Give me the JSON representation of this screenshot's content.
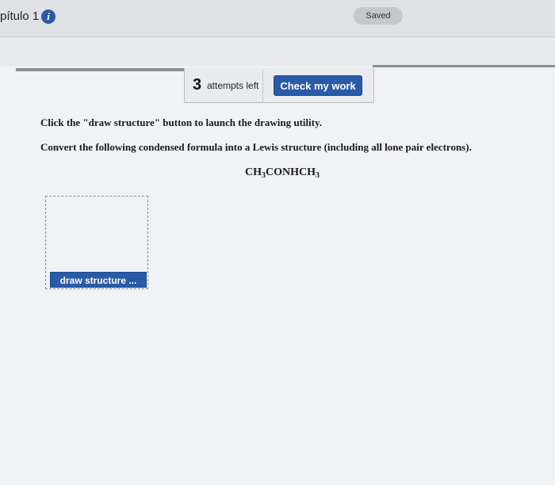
{
  "header": {
    "chapter_label": "pítulo 1",
    "saved_label": "Saved"
  },
  "attempts": {
    "count": "3",
    "label": "attempts left",
    "check_button": "Check my work"
  },
  "question": {
    "instruction_1": "Click the \"draw structure\" button to launch the drawing utility.",
    "instruction_2": "Convert the following condensed formula into a Lewis structure (including all lone pair electrons).",
    "formula_parts": [
      "CH",
      "3",
      "CONHCH",
      "3"
    ]
  },
  "drawing": {
    "button_label": "draw structure ..."
  },
  "colors": {
    "accent": "#2a5aa8",
    "header_bg": "#dfe1e4",
    "content_bg": "#f0f2f5"
  },
  "icons": {
    "info": "info-icon"
  }
}
